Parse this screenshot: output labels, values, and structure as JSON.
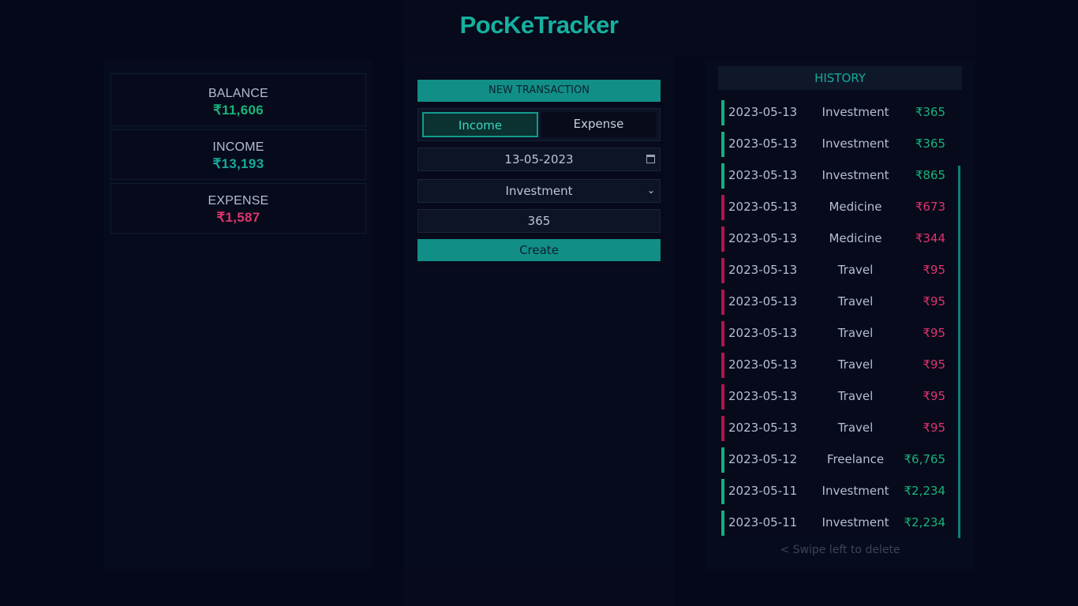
{
  "app": {
    "title": "PocKeTracker"
  },
  "summary": {
    "balance": {
      "label": "BALANCE",
      "value": "₹11,606"
    },
    "income": {
      "label": "INCOME",
      "value": "₹13,193"
    },
    "expense": {
      "label": "EXPENSE",
      "value": "₹1,587"
    }
  },
  "form": {
    "header": "NEW TRANSACTION",
    "toggle": {
      "income_label": "Income",
      "expense_label": "Expense",
      "selected": "Income"
    },
    "date_value": "13-05-2023",
    "category_selected": "Investment",
    "amount_value": "365",
    "create_label": "Create"
  },
  "history": {
    "header": "HISTORY",
    "rows": [
      {
        "date": "2023-05-13",
        "category": "Investment",
        "amount": "₹365",
        "type": "income"
      },
      {
        "date": "2023-05-13",
        "category": "Investment",
        "amount": "₹365",
        "type": "income"
      },
      {
        "date": "2023-05-13",
        "category": "Investment",
        "amount": "₹865",
        "type": "income"
      },
      {
        "date": "2023-05-13",
        "category": "Medicine",
        "amount": "₹673",
        "type": "expense"
      },
      {
        "date": "2023-05-13",
        "category": "Medicine",
        "amount": "₹344",
        "type": "expense"
      },
      {
        "date": "2023-05-13",
        "category": "Travel",
        "amount": "₹95",
        "type": "expense"
      },
      {
        "date": "2023-05-13",
        "category": "Travel",
        "amount": "₹95",
        "type": "expense"
      },
      {
        "date": "2023-05-13",
        "category": "Travel",
        "amount": "₹95",
        "type": "expense"
      },
      {
        "date": "2023-05-13",
        "category": "Travel",
        "amount": "₹95",
        "type": "expense"
      },
      {
        "date": "2023-05-13",
        "category": "Travel",
        "amount": "₹95",
        "type": "expense"
      },
      {
        "date": "2023-05-13",
        "category": "Travel",
        "amount": "₹95",
        "type": "expense"
      },
      {
        "date": "2023-05-12",
        "category": "Freelance",
        "amount": "₹6,765",
        "type": "income"
      },
      {
        "date": "2023-05-11",
        "category": "Investment",
        "amount": "₹2,234",
        "type": "income"
      },
      {
        "date": "2023-05-11",
        "category": "Investment",
        "amount": "₹2,234",
        "type": "income"
      }
    ],
    "swipe_hint": "< Swipe left to delete"
  },
  "colors": {
    "accent": "#118f86",
    "income": "#19b37a",
    "expense": "#e0336e",
    "income_bar": "#13b07f",
    "expense_bar": "#b3154a"
  }
}
